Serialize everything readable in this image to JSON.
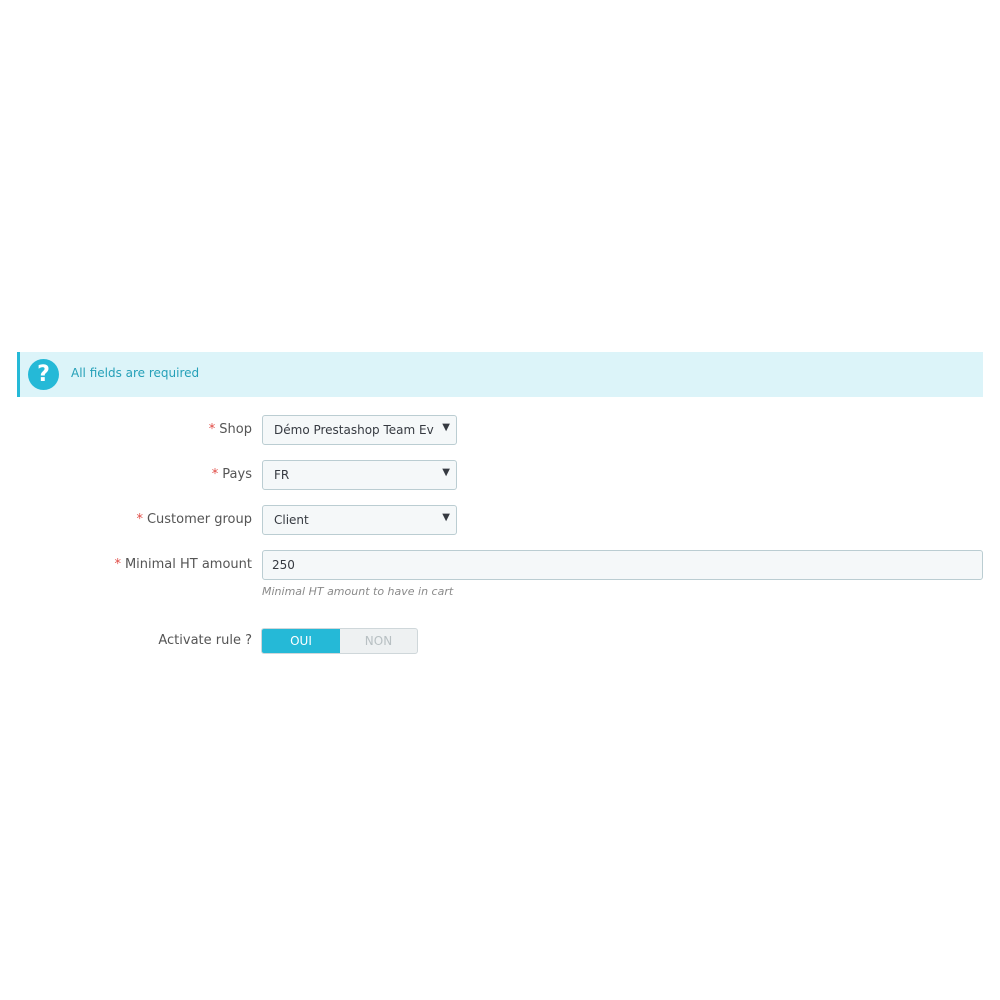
{
  "alert": {
    "icon": "question-circle-icon",
    "text": "All fields are required",
    "color": "#25b9d7",
    "background": "#dcf4f9"
  },
  "form": {
    "required_marker": "*",
    "shop": {
      "label": "Shop",
      "value": "Démo Prestashop Team Ever"
    },
    "pays": {
      "label": "Pays",
      "value": "FR"
    },
    "customer_group": {
      "label": "Customer group",
      "value": "Client"
    },
    "minimal_amount": {
      "label": "Minimal HT amount",
      "value": "250",
      "help": "Minimal HT amount to have in cart"
    },
    "activate_rule": {
      "label": "Activate rule ?",
      "on_label": "OUI",
      "off_label": "NON",
      "selected": "OUI"
    }
  },
  "colors": {
    "accent": "#25b9d7",
    "required": "#e04a44"
  }
}
